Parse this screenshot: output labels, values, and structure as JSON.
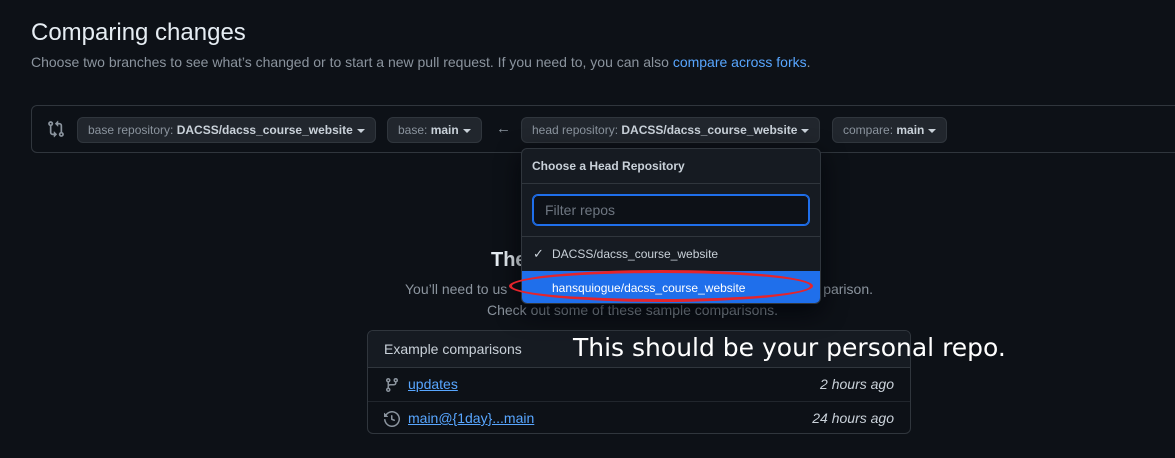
{
  "header": {
    "title": "Comparing changes",
    "subtitle": "Choose two branches to see what’s changed or to start a new pull request. If you need to, you can also ",
    "subtitle_link": "compare across forks",
    "subtitle_end": "."
  },
  "range": {
    "base_repo_prefix": "base repository: ",
    "base_repo_value": "DACSS/dacss_course_website",
    "base_prefix": "base: ",
    "base_value": "main",
    "arrow": "←",
    "head_repo_prefix": "head repository: ",
    "head_repo_value": "DACSS/dacss_course_website",
    "compare_prefix": "compare: ",
    "compare_value": "main"
  },
  "dropdown": {
    "title": "Choose a Head Repository",
    "filter_placeholder": "Filter repos",
    "items": [
      {
        "label": "DACSS/dacss_course_website",
        "checked": true
      },
      {
        "label": "hansquiogue/dacss_course_website",
        "highlighted": true
      }
    ]
  },
  "blankslate": {
    "title_visible": "The",
    "line1_left": "You’ll need to us",
    "line1_right": "parison.",
    "line2": "Check out some of these sample comparisons."
  },
  "examples": {
    "header": "Example comparisons",
    "rows": [
      {
        "icon": "git-branch-icon",
        "label": "updates",
        "time": "2 hours ago"
      },
      {
        "icon": "history-icon",
        "label": "main@{1day}...main",
        "time": "24 hours ago"
      }
    ]
  },
  "annotation": "This should be your personal repo.",
  "colors": {
    "background": "#0d1117",
    "accent": "#58a6ff",
    "selected": "#1f6feb",
    "annotation_ellipse": "#e5242b"
  }
}
